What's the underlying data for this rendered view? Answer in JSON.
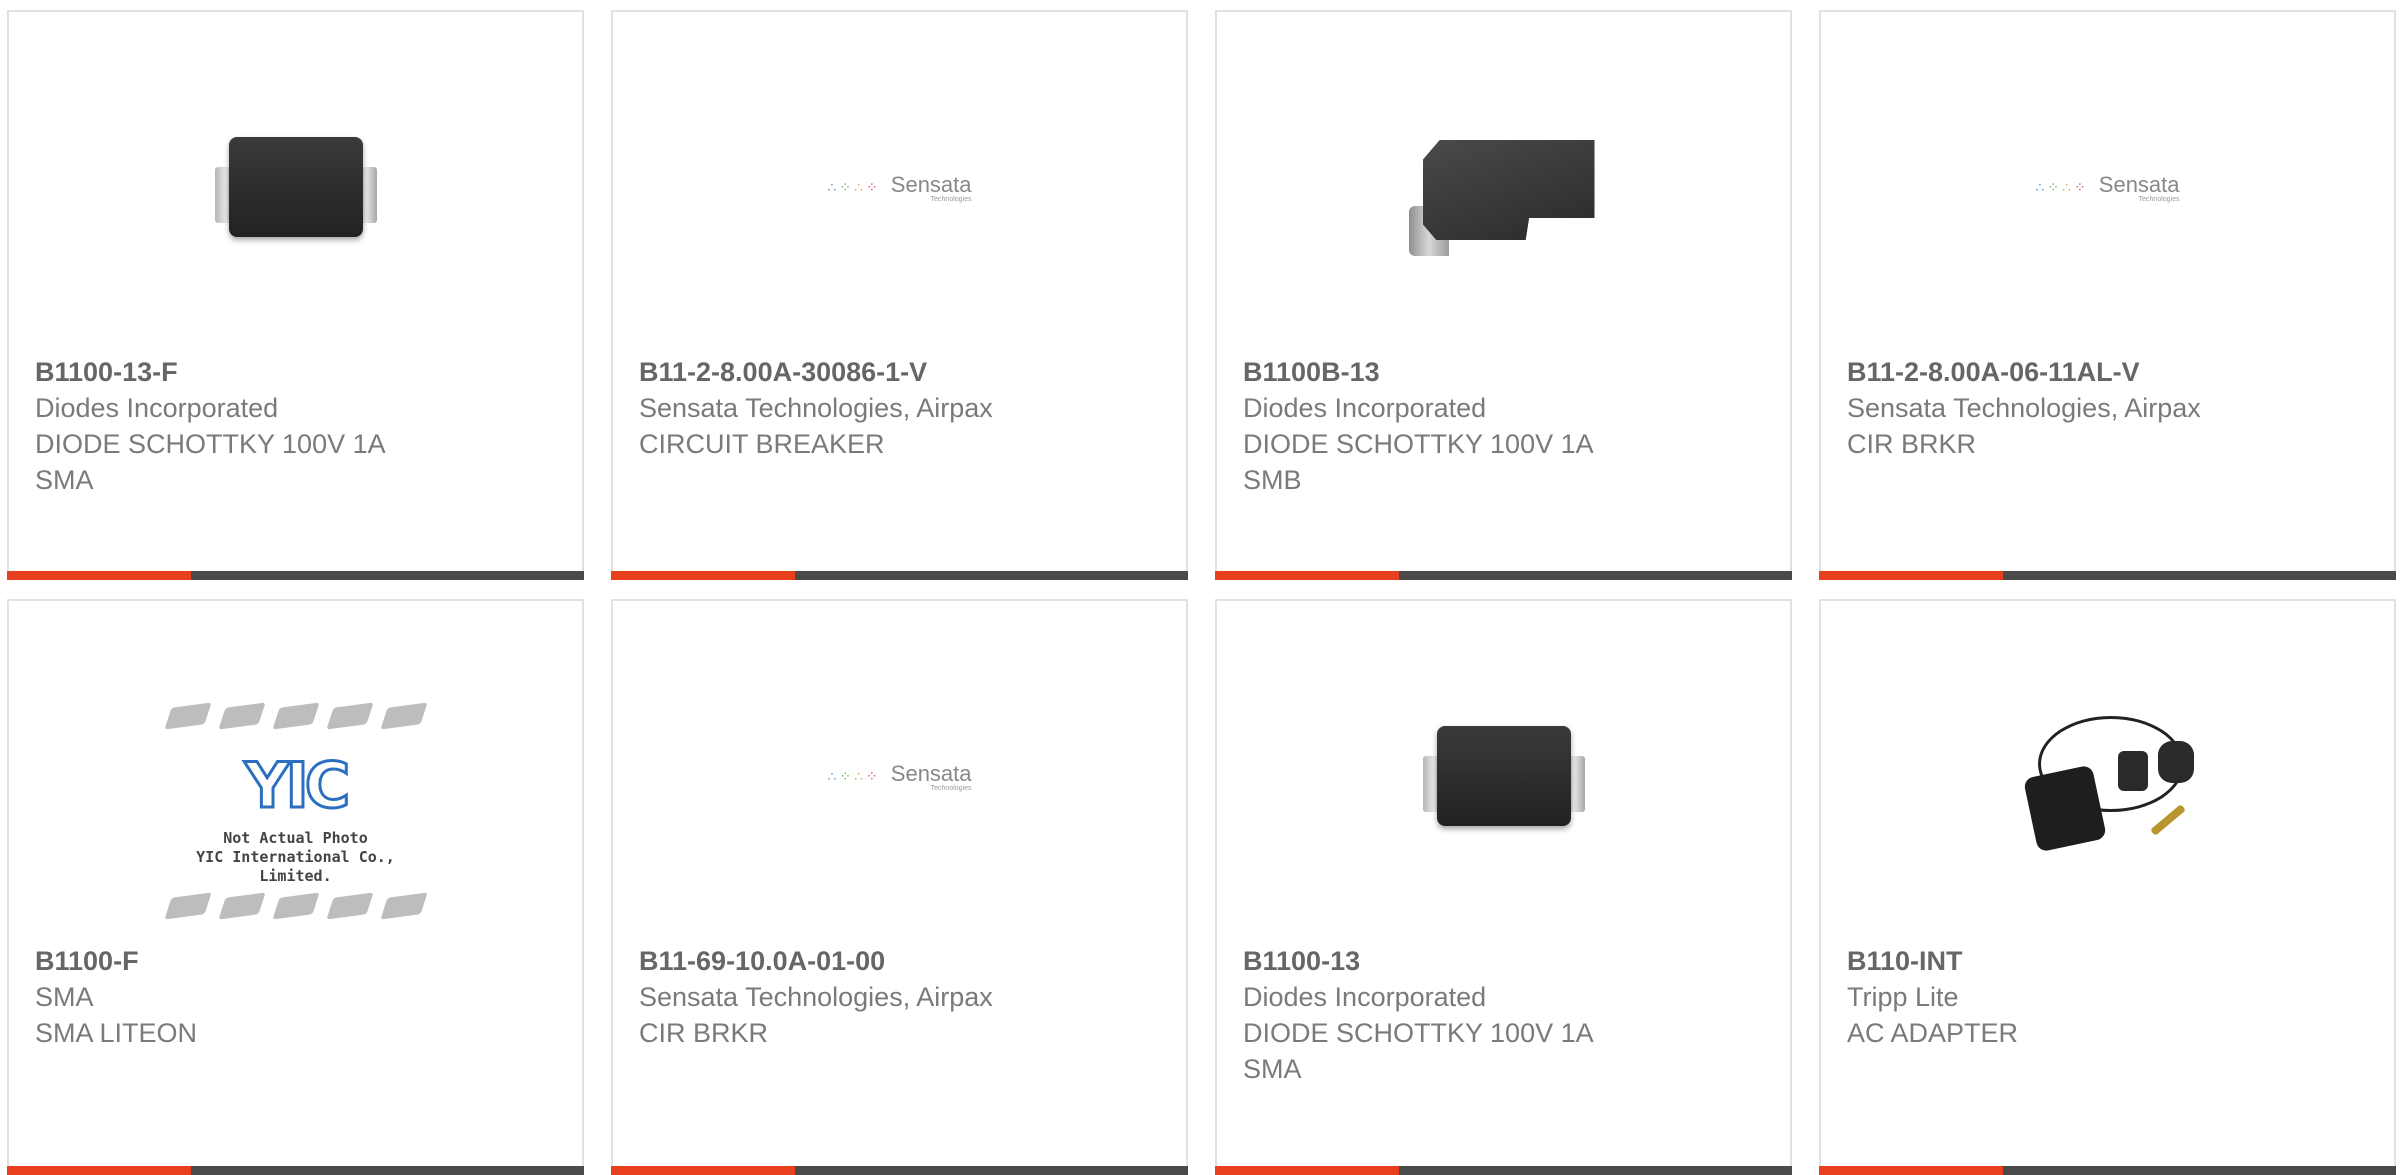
{
  "products": [
    {
      "part": "B1100-13-F",
      "lines": [
        "Diodes Incorporated",
        "DIODE SCHOTTKY 100V 1A",
        "SMA"
      ],
      "image": "sma-diode-image"
    },
    {
      "part": "B11-2-8.00A-30086-1-V",
      "lines": [
        "Sensata Technologies, Airpax",
        "CIRCUIT BREAKER"
      ],
      "image": "sensata-logo"
    },
    {
      "part": "B1100B-13",
      "lines": [
        "Diodes Incorporated",
        "DIODE SCHOTTKY 100V 1A",
        "SMB"
      ],
      "image": "smb-diode-image"
    },
    {
      "part": "B11-2-8.00A-06-11AL-V",
      "lines": [
        "Sensata Technologies, Airpax",
        "CIR BRKR"
      ],
      "image": "sensata-logo"
    },
    {
      "part": "B1100-F",
      "lines": [
        "SMA",
        "SMA LITEON"
      ],
      "image": "yic-placeholder-image"
    },
    {
      "part": "B11-69-10.0A-01-00",
      "lines": [
        "Sensata Technologies, Airpax",
        "CIR BRKR"
      ],
      "image": "sensata-logo"
    },
    {
      "part": "B1100-13",
      "lines": [
        "Diodes Incorporated",
        "DIODE SCHOTTKY 100V 1A",
        "SMA"
      ],
      "image": "sma-diode-image"
    },
    {
      "part": "B110-INT",
      "lines": [
        "Tripp Lite",
        "AC ADAPTER"
      ],
      "image": "ac-adapter-image"
    }
  ],
  "logos": {
    "sensata": {
      "name": "Sensata",
      "tagline": "Technologies"
    },
    "yic": {
      "mark": "YIC",
      "caption1": "Not Actual Photo",
      "caption2": "YIC International Co., Limited."
    }
  },
  "colors": {
    "accent": "#e8401c",
    "bar": "#4a4a4a",
    "border": "#e2e2e2"
  }
}
